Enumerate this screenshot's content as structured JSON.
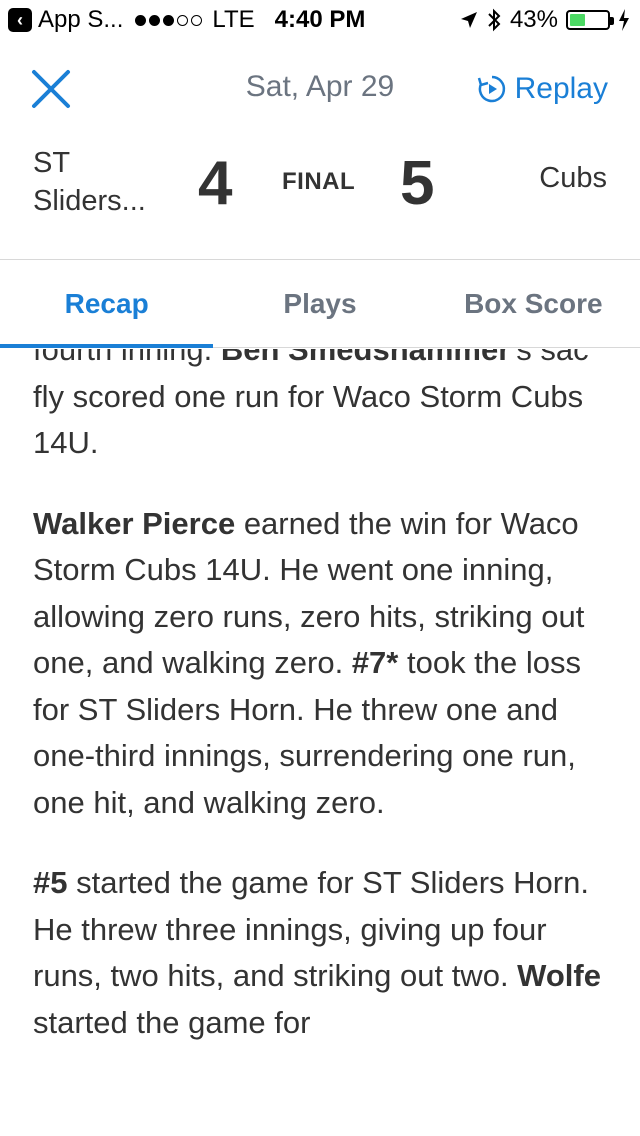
{
  "status_bar": {
    "back_app": "App S...",
    "carrier": "LTE",
    "time": "4:40 PM",
    "battery_percent": "43%",
    "battery_level": 0.43
  },
  "header": {
    "date": "Sat, Apr 29",
    "replay_label": "Replay",
    "accent_color": "#1a7fd6"
  },
  "score": {
    "home_team_line1": "ST",
    "home_team_line2": "Sliders...",
    "home_score": "4",
    "status": "FINAL",
    "away_score": "5",
    "away_team": "Cubs"
  },
  "tabs": [
    {
      "label": "Recap",
      "active": true
    },
    {
      "label": "Plays",
      "active": false
    },
    {
      "label": "Box Score",
      "active": false
    }
  ],
  "article": {
    "p1": {
      "prefix": "fourth inning.  ",
      "name": "Ben Smedshammer",
      "suffix": "'s sac fly scored one run for Waco Storm Cubs 14U."
    },
    "p2": {
      "name1": "Walker Pierce",
      "text1": " earned the win for Waco Storm Cubs 14U. He went one inning, allowing zero runs, zero hits, striking out one, and walking zero.  ",
      "name2": "#7*",
      "text2": " took the loss for ST Sliders Horn. He threw one and one-third innings, surrendering one run, one hit, and walking zero."
    },
    "p3": {
      "name1": "#5",
      "text1": " started the game for ST Sliders Horn. He threw three innings, giving up four runs, two hits, and striking out two.  ",
      "name2": "Wolfe",
      "text2": " started the game for"
    }
  }
}
